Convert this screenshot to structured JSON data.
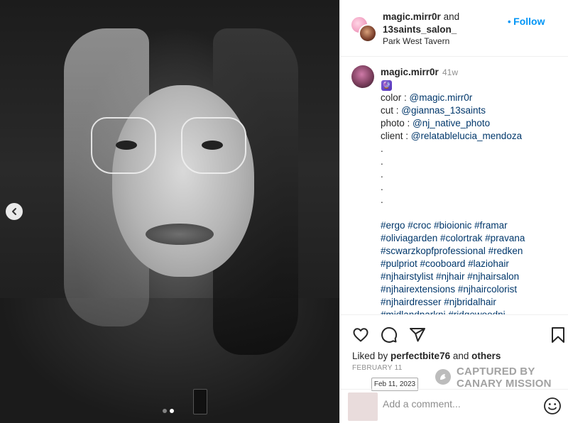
{
  "header": {
    "user1": "magic.mirr0r",
    "and_text": "and",
    "user2": "13saints_salon_",
    "location": "Park West Tavern",
    "follow_label": "Follow"
  },
  "caption": {
    "username": "magic.mirr0r",
    "time_ago": "41w",
    "emoji": "🔮",
    "credit_lines": [
      {
        "label": "color : ",
        "handle": "@magic.mirr0r"
      },
      {
        "label": "cut : ",
        "handle": "@giannas_13saints"
      },
      {
        "label": "photo : ",
        "handle": "@nj_native_photo"
      },
      {
        "label": "client : ",
        "handle": "@relatablelucia_mendoza"
      }
    ],
    "dots": [
      ".",
      ".",
      ".",
      ".",
      "."
    ],
    "hashtag_lines": [
      "#ergo #croc #bioionic #framar",
      "#oliviagarden #colortrak #pravana",
      "#scwarzkopfprofessional #redken",
      "#pulpriot #cooboard #laziohair",
      "#njhairstylist #njhair #njhairsalon",
      "#njhairextensions #njhaircolorist",
      "#njhairdresser #njbridalhair",
      "#midlandparknj #ridgewoodnj"
    ]
  },
  "actions": {
    "like_icon": "heart-icon",
    "comment_icon": "comment-icon",
    "share_icon": "send-icon",
    "save_icon": "bookmark-icon"
  },
  "likes": {
    "prefix": "Liked by ",
    "user": "perfectbite76",
    "middle": " and ",
    "others": "others"
  },
  "date": "FEBRUARY 11",
  "date_tooltip": "Feb 11, 2023",
  "watermark": {
    "line1": "CAPTURED BY",
    "line2": "CANARY MISSION"
  },
  "comment": {
    "placeholder": "Add a comment...",
    "emoji_icon": "smiley-icon"
  },
  "carousel": {
    "prev_icon": "chevron-left-icon",
    "slide_count": 2,
    "active_slide": 2
  }
}
